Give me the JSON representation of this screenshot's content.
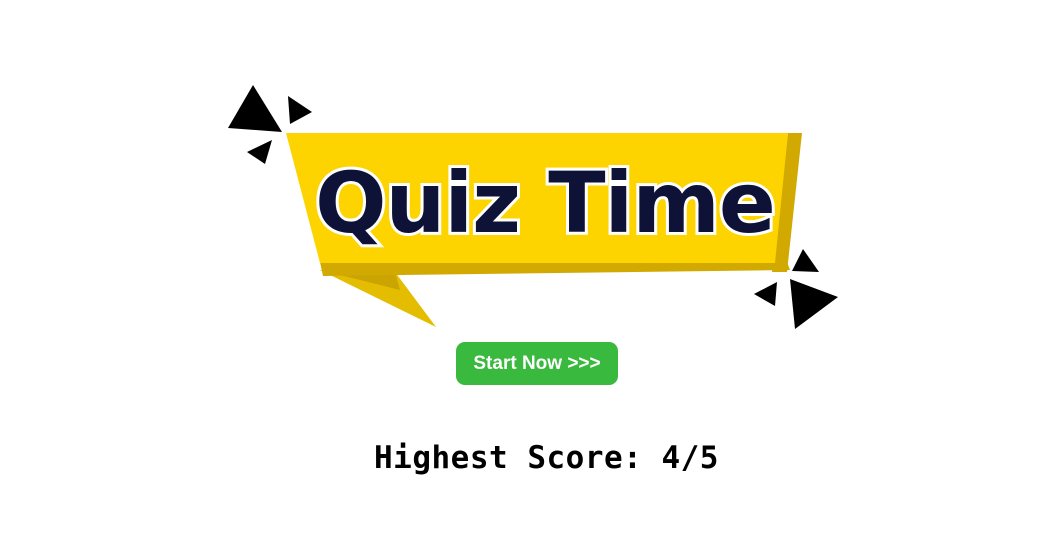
{
  "banner": {
    "title": "Quiz Time"
  },
  "start_button": {
    "label": "Start Now >>>"
  },
  "score": {
    "label": "Highest Score:",
    "value": "4/5"
  },
  "colors": {
    "banner_yellow": "#fdd400",
    "banner_shadow": "#d2a900",
    "banner_tail": "#e4bd00",
    "title_text": "#0d1236",
    "button_green": "#39b93d",
    "triangle_black": "#000000"
  }
}
